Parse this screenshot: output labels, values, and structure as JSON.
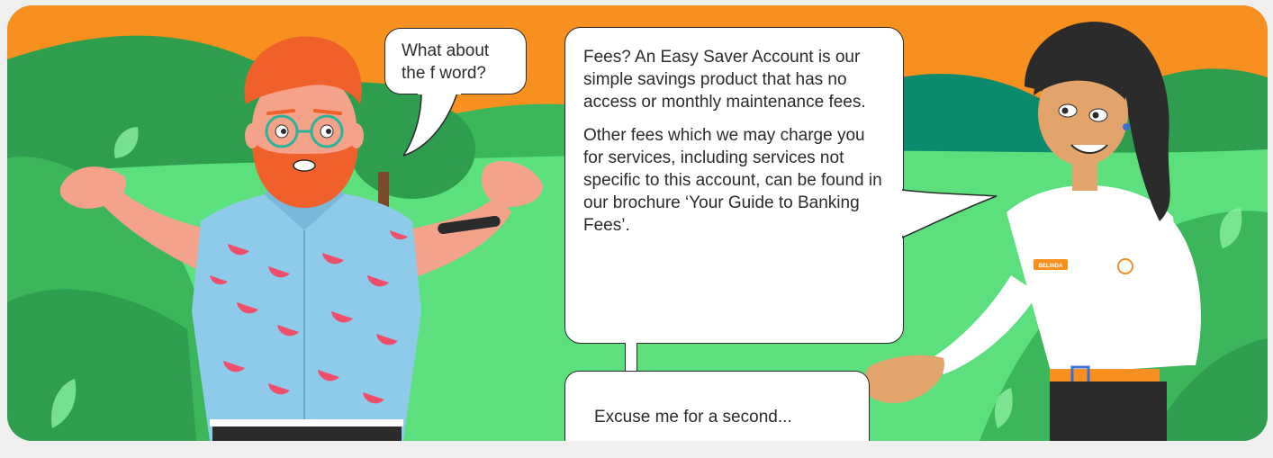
{
  "scene": {
    "colors": {
      "sky": "#f7901e",
      "grass": "#5ce07e",
      "hills_dark": "#2e9e4e",
      "hills_mid": "#3cb65a",
      "teal_hill": "#0b8a6e",
      "brand_orange": "#f7901e"
    }
  },
  "dialogue": {
    "man": {
      "text": "What about the f word?"
    },
    "woman": {
      "paragraph_1": "Fees? An Easy Saver Account is our simple savings product that has no access or monthly maintenance fees.",
      "paragraph_2": "Other fees which we may charge you for services, including services not specific to this account, can be found in our brochure ‘Your Guide to Banking Fees’.",
      "aside": "Excuse me for a second..."
    }
  },
  "characters": {
    "woman": {
      "name_badge": "BELINDA",
      "logo_icon": "w-logo-icon"
    },
    "man": {
      "shirt_pattern": "watermelon-slice-icon"
    }
  }
}
